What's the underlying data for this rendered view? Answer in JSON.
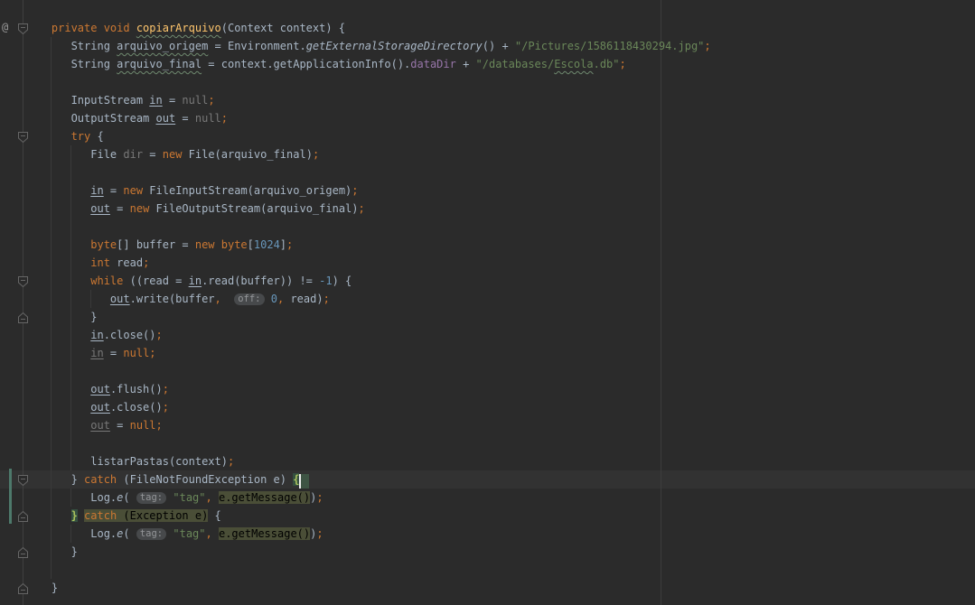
{
  "editor": {
    "gutter": {
      "annotation_icon": "@"
    },
    "caret_line": 26,
    "vcs_changed_lines": [
      26,
      28
    ],
    "fold_markers": [
      {
        "line": 1,
        "dir": "down"
      },
      {
        "line": 7,
        "dir": "down"
      },
      {
        "line": 15,
        "dir": "down"
      },
      {
        "line": 17,
        "dir": "up"
      },
      {
        "line": 26,
        "dir": "down"
      },
      {
        "line": 28,
        "dir": "up"
      },
      {
        "line": 30,
        "dir": "up"
      },
      {
        "line": 32,
        "dir": "up"
      }
    ],
    "colors": {
      "background": "#2b2b2b",
      "caret_row": "#323232",
      "keyword": "#cc7832",
      "string": "#6a8759",
      "number": "#6897bb",
      "field": "#9876aa",
      "default_text": "#a9b7c6",
      "dimmed": "#787878",
      "method_decl": "#ffc66d",
      "fragment_highlight": "#4a4e37",
      "brace_match_bg": "#355040",
      "brace_match_text": "#a9c25d",
      "vcs_change_bar": "#4d796b"
    },
    "lines": [
      [
        [
          "kw",
          "    private void "
        ],
        [
          "mdef",
          "copiarArquivo"
        ],
        [
          "plain",
          "(Context context) {"
        ]
      ],
      [
        [
          "plain",
          "       String "
        ],
        [
          "wavy",
          "arquivo_origem"
        ],
        [
          "plain",
          " = Environment."
        ],
        [
          "itl",
          "getExternalStorageDirectory"
        ],
        [
          "plain",
          "() + "
        ],
        [
          "str",
          "\"/Pictures/1586118430294.jpg\""
        ],
        [
          "punct",
          ";"
        ]
      ],
      [
        [
          "plain",
          "       String "
        ],
        [
          "wavy",
          "arquivo_final"
        ],
        [
          "plain",
          " = context.getApplicationInfo()."
        ],
        [
          "field",
          "dataDir"
        ],
        [
          "plain",
          " + "
        ],
        [
          "str",
          "\"/databases/"
        ],
        [
          "strwavy",
          "Escola"
        ],
        [
          "str",
          ".db\""
        ],
        [
          "punct",
          ";"
        ]
      ],
      [],
      [
        [
          "plain",
          "       InputStream "
        ],
        [
          "ul",
          "in"
        ],
        [
          "plain",
          " = "
        ],
        [
          "gray",
          "null"
        ],
        [
          "punct",
          ";"
        ]
      ],
      [
        [
          "plain",
          "       OutputStream "
        ],
        [
          "ul",
          "out"
        ],
        [
          "plain",
          " = "
        ],
        [
          "gray",
          "null"
        ],
        [
          "punct",
          ";"
        ]
      ],
      [
        [
          "kw",
          "       try "
        ],
        [
          "plain",
          "{"
        ]
      ],
      [
        [
          "plain",
          "          File "
        ],
        [
          "gray",
          "dir"
        ],
        [
          "plain",
          " = "
        ],
        [
          "kw",
          "new"
        ],
        [
          "plain",
          " File(arquivo_final)"
        ],
        [
          "punct",
          ";"
        ]
      ],
      [],
      [
        [
          "plain",
          "          "
        ],
        [
          "ul",
          "in"
        ],
        [
          "plain",
          " = "
        ],
        [
          "kw",
          "new"
        ],
        [
          "plain",
          " FileInputStream(arquivo_origem)"
        ],
        [
          "punct",
          ";"
        ]
      ],
      [
        [
          "plain",
          "          "
        ],
        [
          "ul",
          "out"
        ],
        [
          "plain",
          " = "
        ],
        [
          "kw",
          "new"
        ],
        [
          "plain",
          " FileOutputStream(arquivo_final)"
        ],
        [
          "punct",
          ";"
        ]
      ],
      [],
      [
        [
          "plain",
          "          "
        ],
        [
          "kw",
          "byte"
        ],
        [
          "plain",
          "[] buffer = "
        ],
        [
          "kw",
          "new byte"
        ],
        [
          "plain",
          "["
        ],
        [
          "num",
          "1024"
        ],
        [
          "plain",
          "]"
        ],
        [
          "punct",
          ";"
        ]
      ],
      [
        [
          "plain",
          "          "
        ],
        [
          "kw",
          "int"
        ],
        [
          "plain",
          " read"
        ],
        [
          "punct",
          ";"
        ]
      ],
      [
        [
          "plain",
          "          "
        ],
        [
          "kw",
          "while"
        ],
        [
          "plain",
          " ((read = "
        ],
        [
          "ul",
          "in"
        ],
        [
          "plain",
          ".read(buffer)) != "
        ],
        [
          "num",
          "-1"
        ],
        [
          "plain",
          ") {"
        ]
      ],
      [
        [
          "plain",
          "             "
        ],
        [
          "ul",
          "out"
        ],
        [
          "plain",
          ".write(buffer"
        ],
        [
          "punct",
          ","
        ],
        [
          "plain",
          "  "
        ],
        [
          "hint",
          "off:"
        ],
        [
          "plain",
          " "
        ],
        [
          "num",
          "0"
        ],
        [
          "punct",
          ","
        ],
        [
          "plain",
          " read)"
        ],
        [
          "punct",
          ";"
        ]
      ],
      [
        [
          "plain",
          "          }"
        ]
      ],
      [
        [
          "plain",
          "          "
        ],
        [
          "ul",
          "in"
        ],
        [
          "plain",
          ".close()"
        ],
        [
          "punct",
          ";"
        ]
      ],
      [
        [
          "plain",
          "          "
        ],
        [
          "grayul",
          "in"
        ],
        [
          "plain",
          " = "
        ],
        [
          "kw",
          "null"
        ],
        [
          "punct",
          ";"
        ]
      ],
      [],
      [
        [
          "plain",
          "          "
        ],
        [
          "ul",
          "out"
        ],
        [
          "plain",
          ".flush()"
        ],
        [
          "punct",
          ";"
        ]
      ],
      [
        [
          "plain",
          "          "
        ],
        [
          "ul",
          "out"
        ],
        [
          "plain",
          ".close()"
        ],
        [
          "punct",
          ";"
        ]
      ],
      [
        [
          "plain",
          "          "
        ],
        [
          "grayul",
          "out"
        ],
        [
          "plain",
          " = "
        ],
        [
          "kw",
          "null"
        ],
        [
          "punct",
          ";"
        ]
      ],
      [],
      [
        [
          "plain",
          "          listarPastas(context)"
        ],
        [
          "punct",
          ";"
        ]
      ],
      [
        [
          "plain",
          "       } "
        ],
        [
          "kw",
          "catch"
        ],
        [
          "plain",
          " (FileNotFoundException e) "
        ],
        [
          "bmatch",
          "{"
        ],
        [
          "caret",
          ""
        ],
        [
          "caretbox",
          ""
        ]
      ],
      [
        [
          "plain",
          "          Log."
        ],
        [
          "itl",
          "e"
        ],
        [
          "plain",
          "( "
        ],
        [
          "hint",
          "tag:"
        ],
        [
          "plain",
          " "
        ],
        [
          "str",
          "\"tag\""
        ],
        [
          "punct",
          ","
        ],
        [
          "plain",
          " "
        ],
        [
          "hl",
          "e.getMessage()"
        ],
        [
          "plain",
          ")"
        ],
        [
          "punct",
          ";"
        ]
      ],
      [
        [
          "plain",
          "       "
        ],
        [
          "bmatch",
          "}"
        ],
        [
          "plain",
          " "
        ],
        [
          "kw hl",
          "catch"
        ],
        [
          "hl",
          " (Exception e)"
        ],
        [
          "plain",
          " {"
        ]
      ],
      [
        [
          "plain",
          "          Log."
        ],
        [
          "itl",
          "e"
        ],
        [
          "plain",
          "( "
        ],
        [
          "hint",
          "tag:"
        ],
        [
          "plain",
          " "
        ],
        [
          "str",
          "\"tag\""
        ],
        [
          "punct",
          ","
        ],
        [
          "plain",
          " "
        ],
        [
          "hl",
          "e.getMessage()"
        ],
        [
          "plain",
          ")"
        ],
        [
          "punct",
          ";"
        ]
      ],
      [
        [
          "plain",
          "       }"
        ]
      ],
      [],
      [
        [
          "plain",
          "    }"
        ]
      ]
    ]
  }
}
